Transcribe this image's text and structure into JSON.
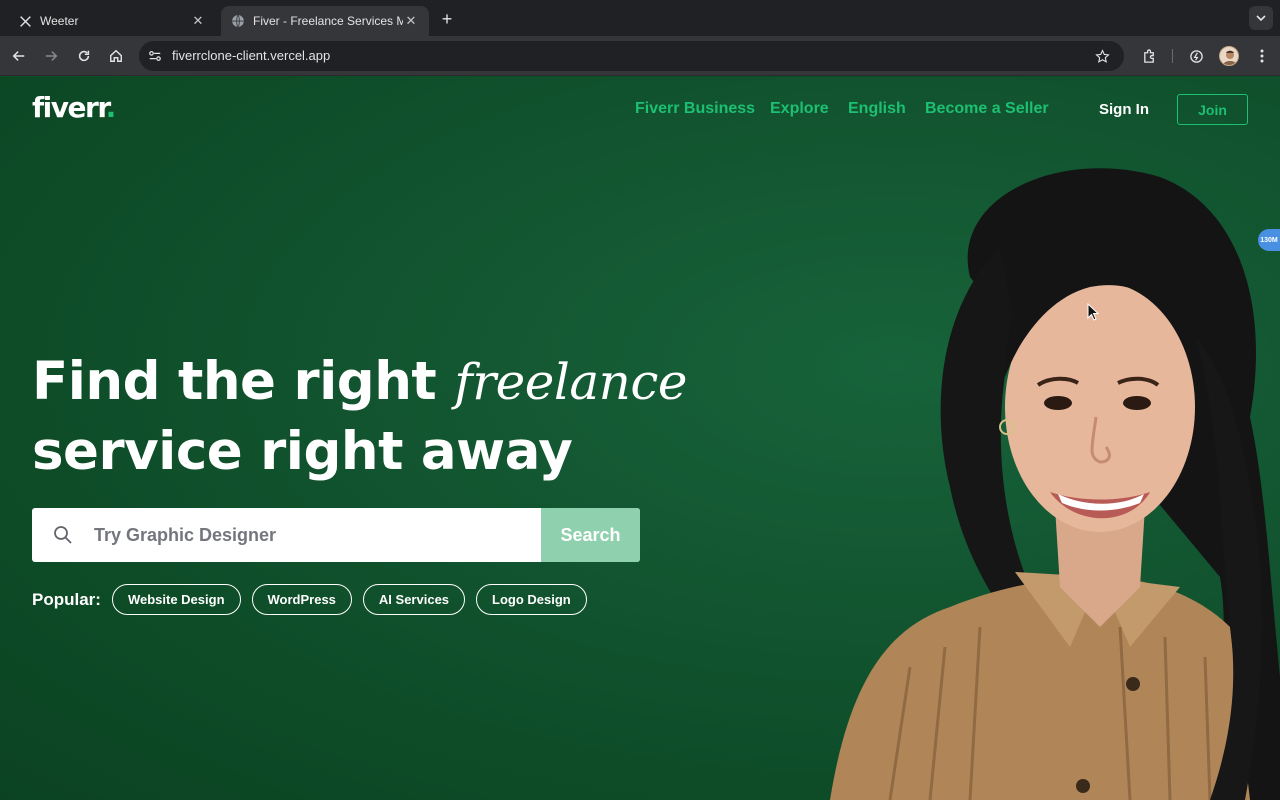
{
  "browser": {
    "tabs": [
      {
        "title": "Weeter",
        "icon": "x-logo-icon",
        "active": false
      },
      {
        "title": "Fiver - Freelance Services Ma",
        "icon": "globe-icon",
        "active": true
      }
    ],
    "address": {
      "url": "fiverrclone-client.vercel.app"
    }
  },
  "header": {
    "logo": {
      "text": "fiverr",
      "dot": "."
    },
    "nav": [
      "Fiverr Business",
      "Explore",
      "English",
      "Become a Seller"
    ],
    "sign_in": "Sign In",
    "join": "Join"
  },
  "hero": {
    "title_part1": "Find the right",
    "title_italic": "freelance",
    "title_line2": "service right away"
  },
  "search": {
    "placeholder": "Try Graphic Designer",
    "button": "Search"
  },
  "popular": {
    "label": "Popular:",
    "items": [
      "Website Design",
      "WordPress",
      "AI Services",
      "Logo Design"
    ]
  },
  "extension_badge": "130M",
  "colors": {
    "brand_green": "#1dbf73",
    "hero_bg": "#0f4d26",
    "search_button": "#8fd1ae"
  }
}
